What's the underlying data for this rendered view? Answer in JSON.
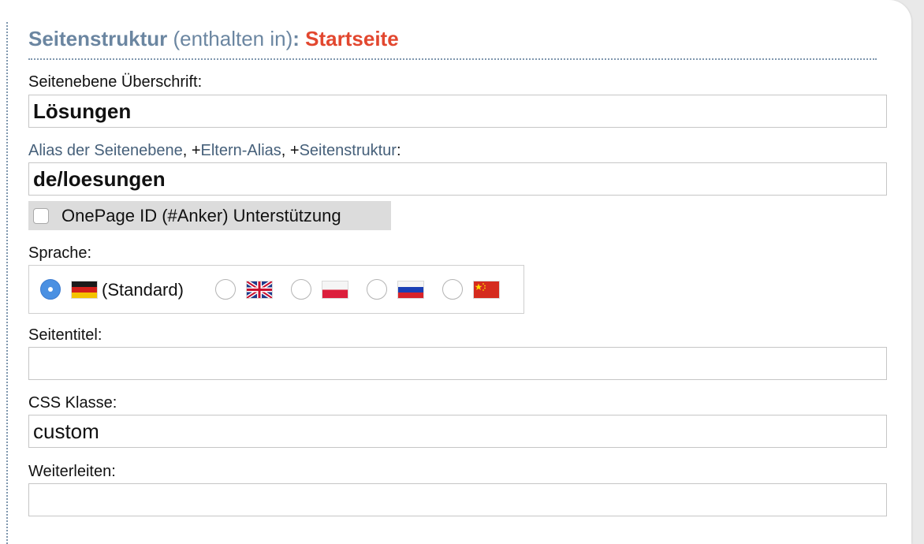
{
  "header": {
    "title_main": "Seitenstruktur",
    "title_paren": "(enthalten in)",
    "title_colon": ":",
    "title_parent": "Startseite"
  },
  "fields": {
    "heading_label": "Seitenebene Überschrift:",
    "heading_value": "Lösungen",
    "alias_label_part1": "Alias der Seitenebene",
    "alias_label_sep1": ", +",
    "alias_label_part2": "Eltern-Alias",
    "alias_label_sep2": ", +",
    "alias_label_part3": "Seitenstruktur",
    "alias_label_end": ":",
    "alias_value": "de/loesungen",
    "onepage_label": "OnePage ID (#Anker) Unterstützung",
    "onepage_checked": false,
    "language_label": "Sprache:",
    "languages": [
      {
        "flag": "flag-germany-icon",
        "label": "(Standard)",
        "selected": true
      },
      {
        "flag": "flag-uk-icon",
        "label": "",
        "selected": false
      },
      {
        "flag": "flag-poland-icon",
        "label": "",
        "selected": false
      },
      {
        "flag": "flag-russia-icon",
        "label": "",
        "selected": false
      },
      {
        "flag": "flag-china-icon",
        "label": "",
        "selected": false
      }
    ],
    "page_title_label": "Seitentitel:",
    "page_title_value": "",
    "css_class_label": "CSS Klasse:",
    "css_class_value": "custom",
    "redirect_label": "Weiterleiten:",
    "redirect_value": ""
  },
  "colors": {
    "accent_blue": "#6b86a1",
    "accent_red": "#e2472f",
    "radio_selected": "#4a90e2"
  }
}
